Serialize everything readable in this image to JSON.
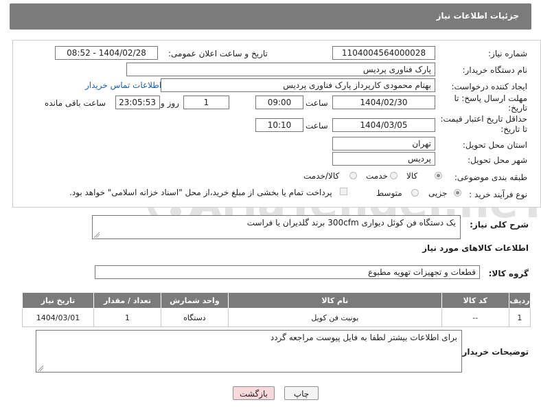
{
  "header": {
    "title": "جزئیات اطلاعات نیاز"
  },
  "form": {
    "need_number": {
      "label": "شماره نیاز:",
      "value": "1104004564000028"
    },
    "announce_datetime": {
      "label": "تاریخ و ساعت اعلان عمومی:",
      "value": "1404/02/28 - 08:52"
    },
    "buyer_org": {
      "label": "نام دستگاه خریدار:",
      "value": "پارک فناوری پردیس"
    },
    "requester": {
      "label": "ایجاد کننده درخواست:",
      "value": "بهنام محمودی کارپرداز پارک فناوری پردیس",
      "contact_link": "اطلاعات تماس خریدار"
    },
    "reply_deadline": {
      "label_line1": "مهلت ارسال پاسخ: تا",
      "label_line2": "تاریخ:",
      "date": "1404/02/30",
      "time_label": "ساعت",
      "time": "09:00",
      "days": "1",
      "days_label": "روز و",
      "remaining": "23:05:53",
      "remaining_label": "ساعت باقی مانده"
    },
    "price_validity": {
      "label_line1": "حداقل تاریخ اعتبار قیمت:",
      "label_line2": "تا تاریخ:",
      "date": "1404/03/05",
      "time_label": "ساعت",
      "time": "10:10"
    },
    "province": {
      "label": "استان محل تحویل:",
      "value": "تهران"
    },
    "city": {
      "label": "شهر محل تحویل:",
      "value": "پردیس"
    },
    "category": {
      "label": "طبقه بندی موضوعی:",
      "options": [
        "کالا",
        "خدمت",
        "کالا/خدمت"
      ],
      "selected": "کالا"
    },
    "purchase_type": {
      "label": "نوع فرآیند خرید :",
      "options": [
        "جزیی",
        "متوسط"
      ],
      "selected": "جزیی",
      "note": "پرداخت تمام یا بخشی از مبلغ خرید،از محل \"اسناد خزانه اسلامی\" خواهد بود."
    }
  },
  "summary": {
    "label": "شرح کلی نیاز:",
    "value": "یک دستگاه فن کوئل دیواری 300cfm برند گلدیران یا فراست"
  },
  "goods_section": {
    "title": "اطلاعات کالاهای مورد نیاز",
    "group_label": "گروه کالا:",
    "group_value": "قطعات و تجهیزات تهویه مطبوع"
  },
  "table": {
    "headers": [
      "ردیف",
      "کد کالا",
      "نام کالا",
      "واحد شمارش",
      "تعداد / مقدار",
      "تاریخ نیاز"
    ],
    "rows": [
      [
        "1",
        "--",
        "یونیت فن کویل",
        "دستگاه",
        "1",
        "1404/03/01"
      ]
    ]
  },
  "buyer_notes": {
    "label": "توضیحات خریدار:",
    "value": "برای اطلاعات بیشتر لطفا به فایل پیوست مراجعه گردد"
  },
  "buttons": {
    "print": "چاپ",
    "back": "بازگشت"
  },
  "watermark": {
    "text": "AriaTender.neT"
  },
  "colors": {
    "header_bg": "#7b7b7b",
    "link": "#1a5fb4",
    "back_button_bg": "#f7d9dc",
    "watermark": "#e2e2e2"
  }
}
